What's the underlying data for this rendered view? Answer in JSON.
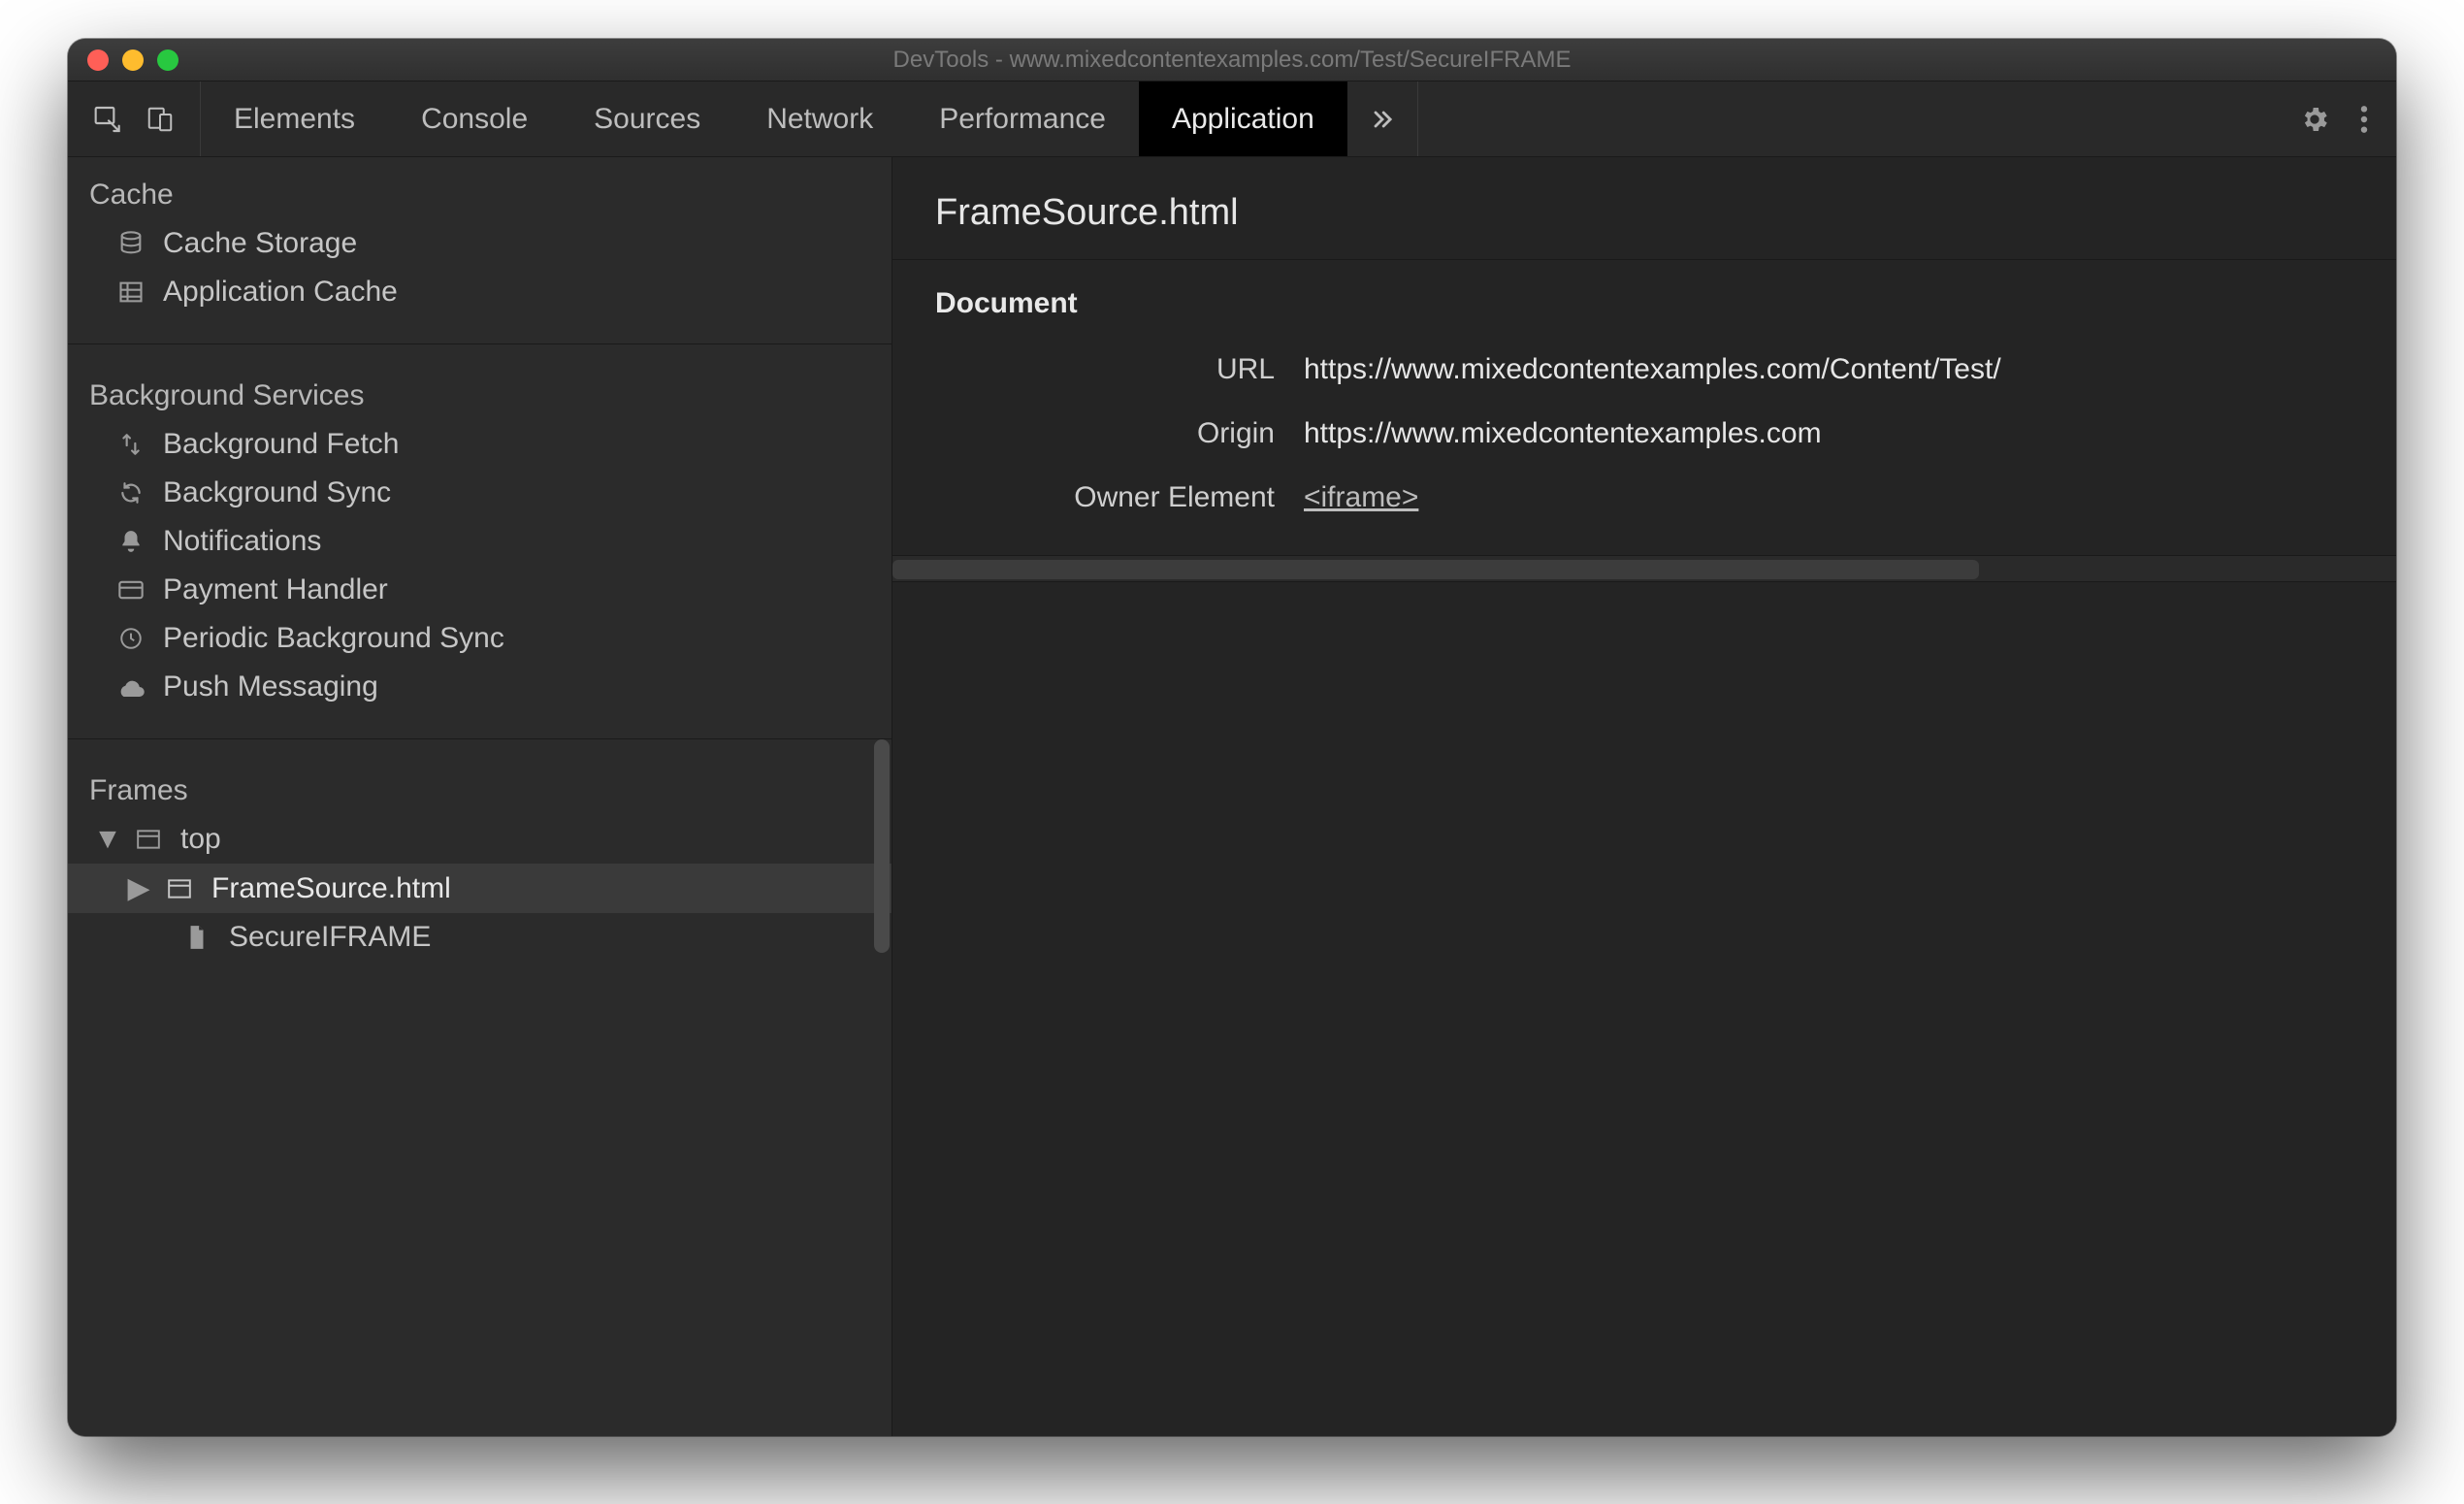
{
  "window": {
    "title": "DevTools - www.mixedcontentexamples.com/Test/SecureIFRAME"
  },
  "toolbar": {
    "tabs": [
      "Elements",
      "Console",
      "Sources",
      "Network",
      "Performance",
      "Application"
    ],
    "active_tab": "Application"
  },
  "sidebar": {
    "sections": {
      "cache": {
        "label": "Cache",
        "items": [
          "Cache Storage",
          "Application Cache"
        ]
      },
      "background_services": {
        "label": "Background Services",
        "items": [
          "Background Fetch",
          "Background Sync",
          "Notifications",
          "Payment Handler",
          "Periodic Background Sync",
          "Push Messaging"
        ]
      },
      "frames": {
        "label": "Frames",
        "tree": {
          "top": "top",
          "children": [
            {
              "label": "FrameSource.html",
              "selected": true
            },
            {
              "label": "SecureIFRAME",
              "selected": false
            }
          ]
        }
      }
    }
  },
  "main": {
    "title": "FrameSource.html",
    "section_title": "Document",
    "rows": {
      "url": {
        "label": "URL",
        "value": "https://www.mixedcontentexamples.com/Content/Test/"
      },
      "origin": {
        "label": "Origin",
        "value": "https://www.mixedcontentexamples.com"
      },
      "owner_element": {
        "label": "Owner Element",
        "value": "<iframe>"
      }
    }
  }
}
